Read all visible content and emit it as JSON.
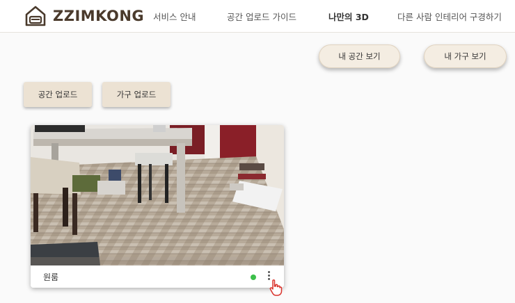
{
  "brand": {
    "name": "ZZIMKONG"
  },
  "nav": {
    "items": [
      {
        "label": "서비스 안내"
      },
      {
        "label": "공간 업로드 가이드"
      },
      {
        "label": "나만의 3D"
      },
      {
        "label": "다른 사람 인테리어 구경하기"
      }
    ]
  },
  "actions": {
    "my_space": "내 공간 보기",
    "my_furniture": "내 가구 보기"
  },
  "upload": {
    "space": "공간 업로드",
    "furniture": "가구 업로드"
  },
  "cards": [
    {
      "title": "원룸",
      "status": "active",
      "status_color": "#3cbf4a"
    }
  ],
  "icons": {
    "logo": "house-logo-icon",
    "menu": "more-vertical-icon",
    "cursor": "hand-pointer-icon"
  },
  "colors": {
    "brand_brown": "#4a3a2c",
    "button_beige": "#ece2d3",
    "pill_beige": "#f4ede2"
  }
}
